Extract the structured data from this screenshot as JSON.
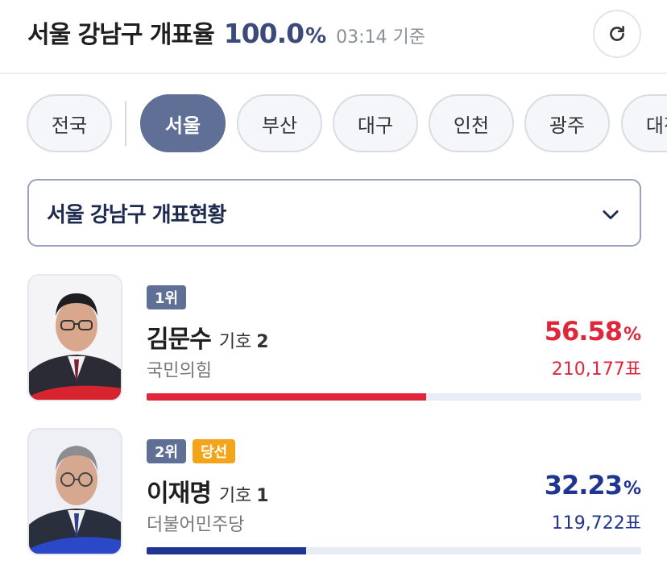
{
  "header": {
    "region": "서울 강남구 개표율",
    "rate": "100.0",
    "rate_unit": "%",
    "time": "03:14 기준"
  },
  "tabs": [
    {
      "label": "전국",
      "active": false
    },
    {
      "label": "서울",
      "active": true
    },
    {
      "label": "부산",
      "active": false
    },
    {
      "label": "대구",
      "active": false
    },
    {
      "label": "인천",
      "active": false
    },
    {
      "label": "광주",
      "active": false
    },
    {
      "label": "대전",
      "active": false
    }
  ],
  "dropdown": {
    "selected": "서울 강남구 개표현황"
  },
  "candidates": [
    {
      "rank": "1위",
      "winner": "",
      "name": "김문수",
      "number_label": "기호",
      "number": "2",
      "party": "국민의힘",
      "percent": "56.58",
      "percent_unit": "%",
      "votes": "210,177표",
      "share": 0.5658,
      "color": "#e0263a",
      "bar_color": "#e0263a"
    },
    {
      "rank": "2위",
      "winner": "당선",
      "name": "이재명",
      "number_label": "기호",
      "number": "1",
      "party": "더불어민주당",
      "percent": "32.23",
      "percent_unit": "%",
      "votes": "119,722표",
      "share": 0.3223,
      "color": "#1f3590",
      "bar_color": "#1f3590"
    }
  ],
  "icons": {
    "refresh": "refresh-icon",
    "chevron": "chevron-down-icon"
  }
}
